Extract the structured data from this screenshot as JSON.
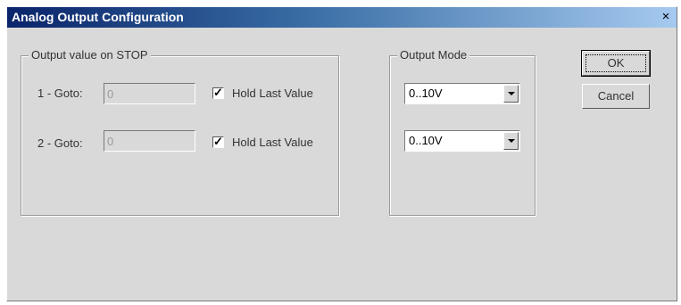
{
  "window": {
    "title": "Analog Output Configuration",
    "close_glyph": "×"
  },
  "stop_group": {
    "legend": "Output value on STOP",
    "rows": [
      {
        "label": "1 - Goto:",
        "value": "0",
        "checkbox_label": "Hold Last Value",
        "checked": true
      },
      {
        "label": "2 - Goto:",
        "value": "0",
        "checkbox_label": "Hold Last Value",
        "checked": true
      }
    ]
  },
  "mode_group": {
    "legend": "Output Mode",
    "selects": [
      {
        "value": "0..10V"
      },
      {
        "value": "0..10V"
      }
    ]
  },
  "buttons": {
    "ok_label": "OK",
    "cancel_label": "Cancel"
  },
  "icons": {
    "check": "check-icon",
    "dropdown": "chevron-down-icon",
    "close": "close-icon"
  }
}
